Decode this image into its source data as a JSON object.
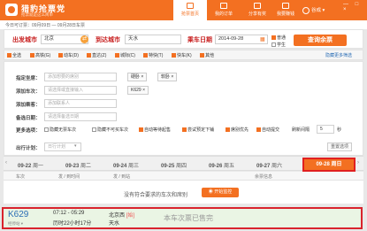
{
  "app": {
    "brand": "猎豹抢票党",
    "slogan": "抢票就是这么简单",
    "user": "谷成",
    "window_icons": "— □ ×"
  },
  "nav": {
    "tabs": [
      {
        "label": "抢票首页"
      },
      {
        "label": "我的订单"
      },
      {
        "label": "分享有奖"
      },
      {
        "label": "我要赚钱"
      }
    ]
  },
  "notice": "今日可订票：09月09日 — 09月28日车票",
  "search": {
    "from_label": "出发城市",
    "from_value": "北京",
    "to_label": "到达城市",
    "to_value": "天水",
    "date_label": "乘车日期",
    "date_value": "2014-09-28",
    "ptype_normal": "普通",
    "ptype_student": "学生",
    "query_button": "查询余票"
  },
  "train_types": [
    "全选",
    "高铁(G)",
    "动车(D)",
    "直达(Z)",
    "城际(C)",
    "特快(T)",
    "快车(K)",
    "其他"
  ],
  "hide_filter": "隐藏更多筛选",
  "panel": {
    "seat_label": "指定坐席：",
    "seat_placeholder": "添加想要的席别",
    "seats": [
      "硬卧",
      "软卧"
    ],
    "train_label": "添加车次：",
    "train_placeholder": "请选择或直接输入",
    "trains": [
      "K629"
    ],
    "passenger_label": "添加乘客：",
    "passenger_placeholder": "添加联系人",
    "date_label": "备选日期：",
    "date_placeholder": "请选择备选日期",
    "more_label": "更多选项：",
    "more_options": [
      "隐藏无票车次",
      "隐藏不可买车次",
      "自动等待起售",
      "尝试预定下铺",
      "席别优先",
      "自动提交",
      "刷新间隔"
    ],
    "refresh_value": "5",
    "refresh_unit": "秒",
    "plan_label": "出行计划：",
    "plan_placeholder": "日行计划",
    "reset_button": "重置选项"
  },
  "dates": [
    {
      "date": "09-22",
      "day": "周一"
    },
    {
      "date": "09-23",
      "day": "周二"
    },
    {
      "date": "09-24",
      "day": "周三"
    },
    {
      "date": "09-25",
      "day": "周四"
    },
    {
      "date": "09-26",
      "day": "周五"
    },
    {
      "date": "09-27",
      "day": "周六"
    }
  ],
  "active_date": {
    "date": "09-28",
    "day": "周日"
  },
  "columns": [
    "车次",
    "发 / 到时间",
    "发 / 到站",
    "余票信息"
  ],
  "no_ticket_msg": "没有符合要求的车次和席别",
  "monitor_button": "开始监控",
  "result": {
    "train": "K629",
    "train_sub": "经停站 ▾",
    "depart": "07:12",
    "arrive": "05:29",
    "duration": "历时22小时17分",
    "from": "北京西",
    "from_badge": "始",
    "to": "天水",
    "status": "本车次票已售完"
  },
  "colors": {
    "brand": "#f37021",
    "highlight": "#d9232d",
    "result_bg": "#eaf5e4"
  }
}
